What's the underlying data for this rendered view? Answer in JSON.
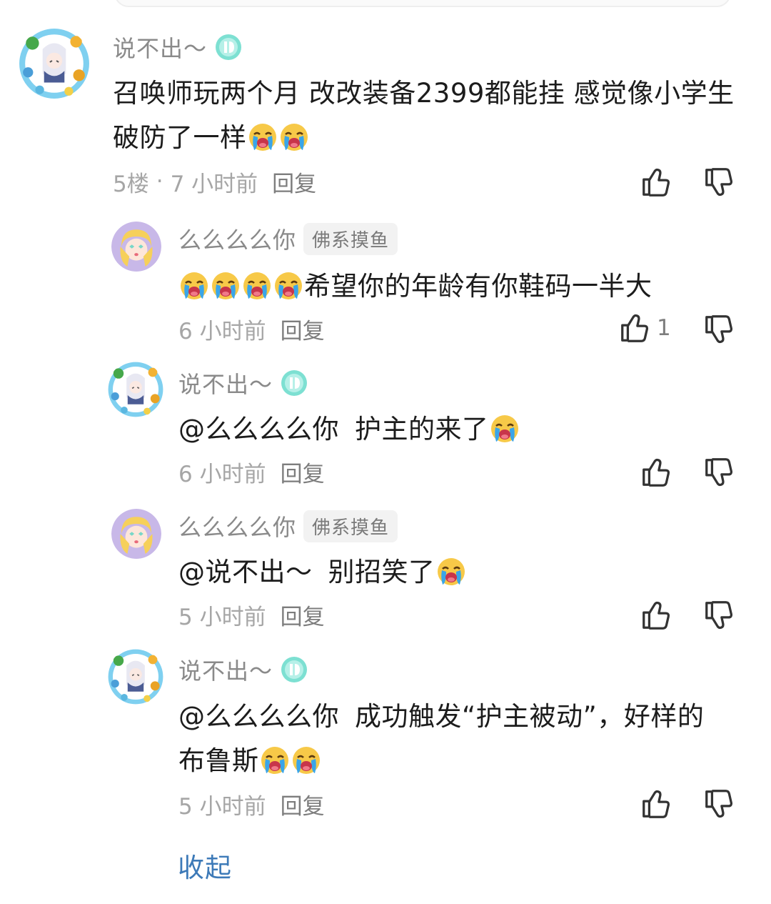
{
  "comments": [
    {
      "username": "说不出～",
      "badge": "teal-level-badge-icon",
      "text": "召唤师玩两个月 改改装备2399都能挂 感觉像小学生破防了一样",
      "emojis": 2,
      "floor": "5楼",
      "separator": "·",
      "time": "7 小时前",
      "reply_label": "回复"
    },
    {
      "username": "么么么么你",
      "tag": "佛系摸鱼",
      "text": "希望你的年龄有你鞋码一半大",
      "emojis_before": 4,
      "time": "6 小时前",
      "reply_label": "回复",
      "like_count": "1"
    },
    {
      "username": "说不出～",
      "badge": "teal-level-badge-icon",
      "mention": "@么么么么你",
      "text": "护主的来了",
      "emojis": 1,
      "time": "6 小时前",
      "reply_label": "回复"
    },
    {
      "username": "么么么么你",
      "tag": "佛系摸鱼",
      "mention": "@说不出～",
      "text": "别招笑了",
      "emojis": 1,
      "time": "5 小时前",
      "reply_label": "回复"
    },
    {
      "username": "说不出～",
      "badge": "teal-level-badge-icon",
      "mention": "@么么么么你",
      "text": "成功触发“护主被动”，好样的",
      "text2": "布鲁斯",
      "emojis": 2,
      "time": "5 小时前",
      "reply_label": "回复"
    }
  ],
  "collapse_label": "收起",
  "icons": {
    "like": "thumbs-up-icon",
    "dislike": "thumbs-down-icon",
    "emoji": "crying-face-emoji"
  },
  "colors": {
    "link": "#3d7ab8",
    "badge_teal": "#5cd6c4",
    "secondary_text": "#a6a6a6"
  }
}
